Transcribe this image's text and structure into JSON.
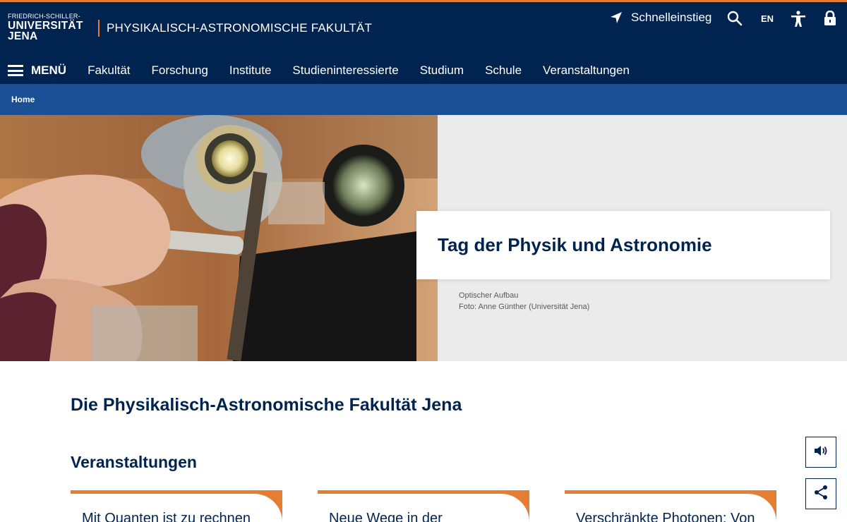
{
  "header": {
    "logo": {
      "line1": "FRIEDRICH-SCHILLER-",
      "line2": "UNIVERSITÄT",
      "line3": "JENA"
    },
    "faculty_title": "PHYSIKALISCH-ASTRONOMISCHE FAKULTÄT",
    "quick_access_label": "Schnelleinstieg",
    "language_label": "EN",
    "accent_color": "#e57d32",
    "brand_color": "#002350"
  },
  "nav": {
    "menu_label": "MENÜ",
    "items": [
      "Fakultät",
      "Forschung",
      "Institute",
      "Studieninteressierte",
      "Studium",
      "Schule",
      "Veranstaltungen"
    ]
  },
  "breadcrumb": {
    "home": "Home"
  },
  "hero": {
    "title": "Tag der Physik und Astronomie",
    "caption_line1": "Optischer Aufbau",
    "caption_line2": "Foto: Anne Günther (Universität Jena)"
  },
  "main": {
    "heading": "Die Physikalisch-Astronomische Fakultät Jena",
    "events_heading": "Veranstaltungen",
    "cards": [
      {
        "title": "Mit Quanten ist zu rechnen"
      },
      {
        "title": "Neue Wege in der"
      },
      {
        "title": "Verschränkte Photonen: Von"
      }
    ]
  },
  "icons": {
    "quick_access": "navigation-arrow-icon",
    "search": "search-icon",
    "accessibility": "accessibility-icon",
    "login": "lock-icon",
    "audio": "speaker-icon",
    "share": "share-icon"
  }
}
